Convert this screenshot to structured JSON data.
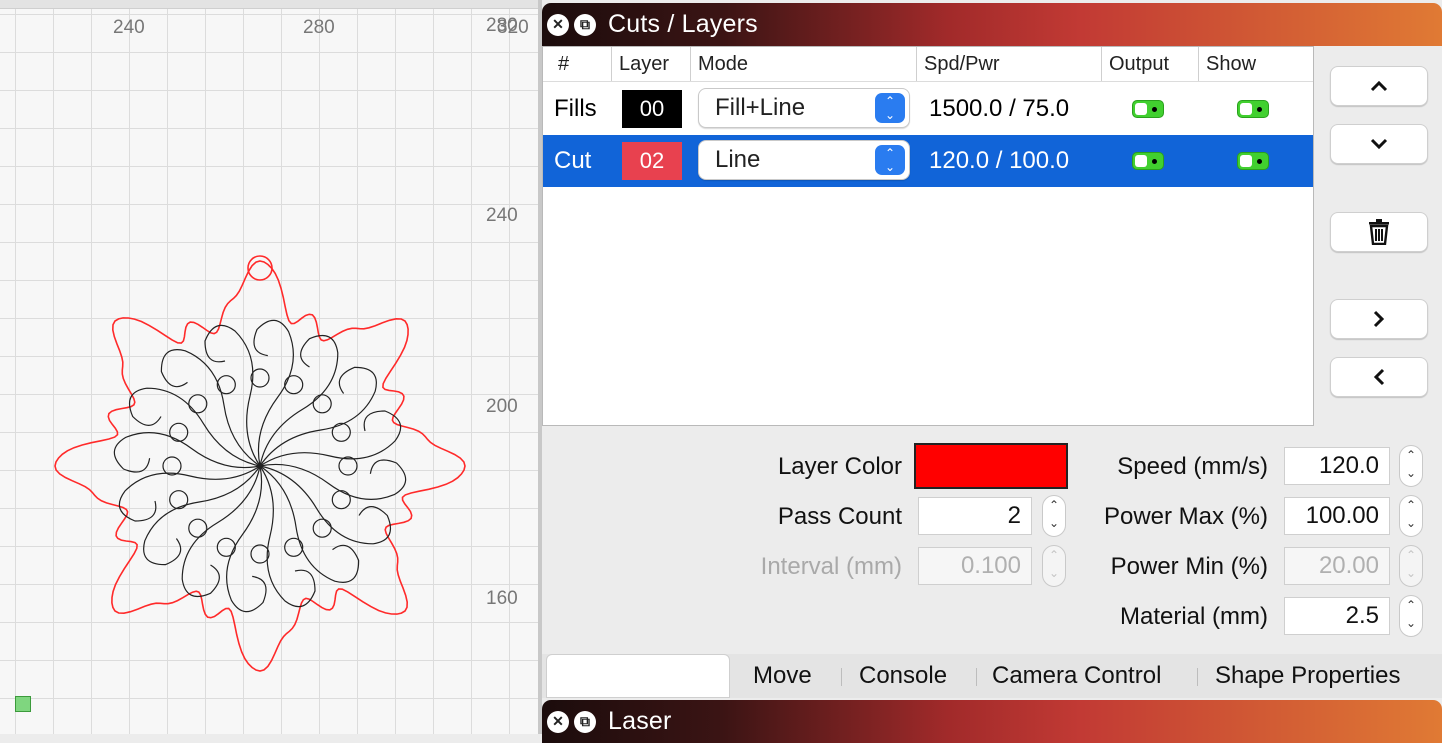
{
  "canvas": {
    "x_ticks": [
      "240",
      "280",
      "280",
      "320"
    ],
    "y_ticks": [
      "240",
      "200",
      "160"
    ]
  },
  "cuts_panel": {
    "title": "Cuts / Layers",
    "close_icon": "close-icon",
    "float_icon": "float-window-icon",
    "columns": [
      "#",
      "Layer",
      "Mode",
      "Spd/Pwr",
      "Output",
      "Show"
    ],
    "rows": [
      {
        "name": "Fills",
        "layer": "00",
        "layer_color": "#000000",
        "mode": "Fill+Line",
        "spd_pwr": "1500.0 / 75.0",
        "output": true,
        "show": true
      },
      {
        "name": "Cut",
        "layer": "02",
        "layer_color": "#e8414f",
        "mode": "Line",
        "spd_pwr": "120.0 / 100.0",
        "output": true,
        "show": true
      }
    ],
    "selected_row": 1,
    "side_buttons": [
      {
        "name": "move-up",
        "icon": "chevron-up-icon",
        "glyph": "⌃"
      },
      {
        "name": "move-down",
        "icon": "chevron-down-icon",
        "glyph": "⌄"
      },
      {
        "name": "delete",
        "icon": "trash-icon",
        "glyph": "🗑"
      },
      {
        "name": "expand",
        "icon": "chevron-right-icon",
        "glyph": "›"
      },
      {
        "name": "collapse",
        "icon": "chevron-left-icon",
        "glyph": "‹"
      }
    ]
  },
  "properties": {
    "layer_color_label": "Layer Color",
    "layer_color": "#ff0000",
    "pass_count_label": "Pass Count",
    "pass_count": "2",
    "interval_label": "Interval (mm)",
    "interval": "0.100",
    "speed_label": "Speed (mm/s)",
    "speed": "120.0",
    "power_max_label": "Power Max (%)",
    "power_max": "100.00",
    "power_min_label": "Power Min (%)",
    "power_min": "20.00",
    "material_label": "Material (mm)",
    "material": "2.5"
  },
  "tabs": [
    "",
    "Move",
    "Console",
    "Camera Control",
    "Shape Properties"
  ],
  "laser_panel": {
    "title": "Laser"
  }
}
